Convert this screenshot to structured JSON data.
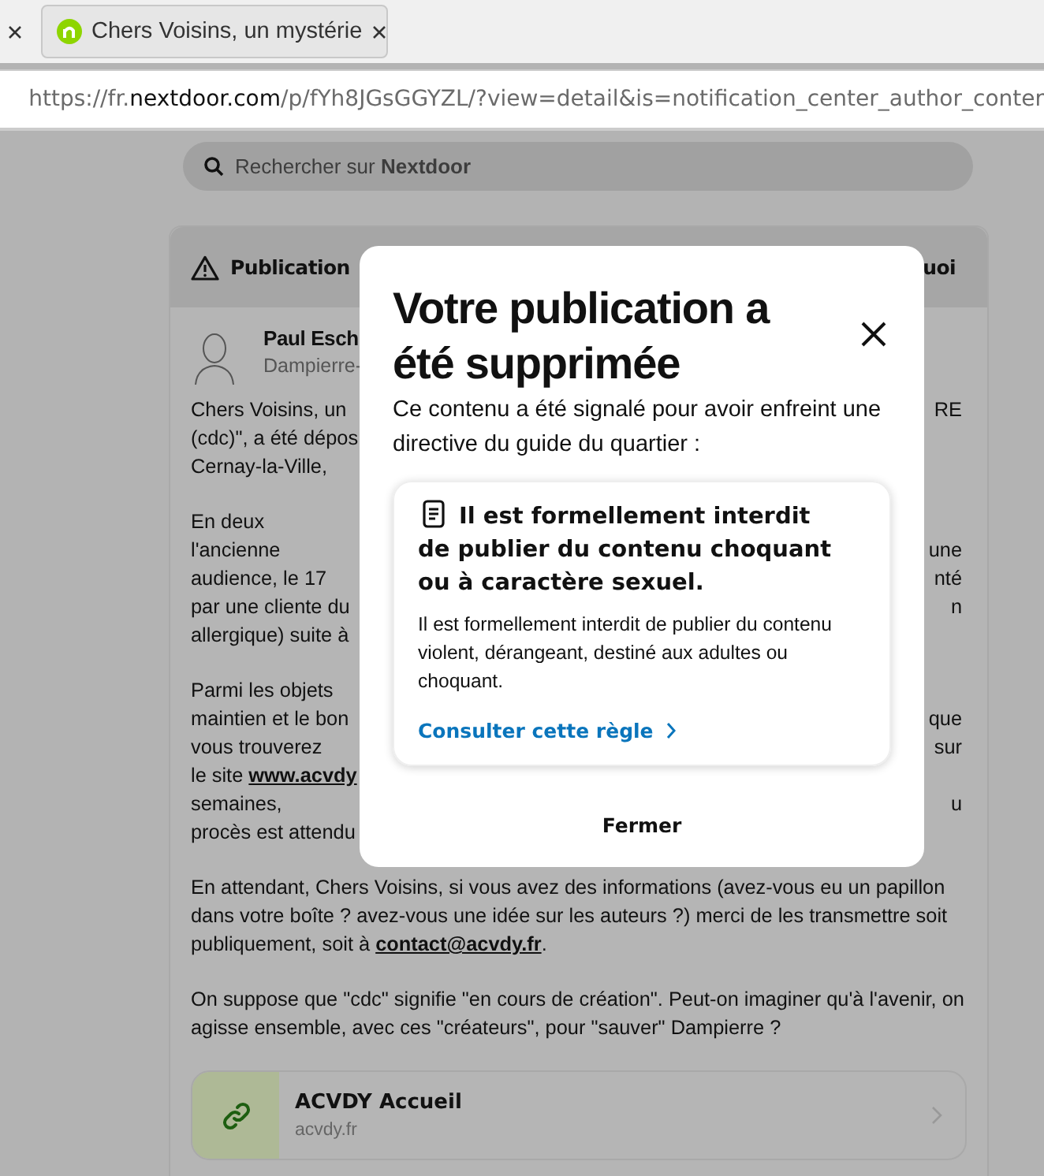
{
  "browser": {
    "tab": {
      "title": "Chers Voisins, un mystérie",
      "selected": true
    },
    "url": {
      "prefix": "https://fr.",
      "domain": "nextdoor.com",
      "path": "/p/fYh8JGsGGYZL/?view=detail&is=notification_center_author_conter"
    }
  },
  "search": {
    "placeholder": "Rechercher sur **Nextdoor**"
  },
  "post": {
    "header_left": "Publication",
    "header_right": "uoi",
    "author": "Paul Esch",
    "location": "Dampierre-",
    "paragraphs": [
      {
        "lines": [
          {
            "left": "Chers Voisins, un ",
            "right": "RE"
          },
          {
            "left": "(cdc)\", a été dépos"
          },
          {
            "left": "Cernay-la-Ville,"
          }
        ]
      },
      {
        "lines": [
          {
            "left": "En deux"
          },
          {
            "left": "l'ancienne",
            "right": "une"
          },
          {
            "left": "audience, le 17",
            "right": "nté"
          },
          {
            "left": "par une cliente du ",
            "right": "n"
          },
          {
            "left": "allergique) suite à "
          }
        ]
      },
      {
        "lines": [
          {
            "left": "Parmi les objets"
          },
          {
            "left": "maintien et le bon ",
            "right": "que"
          },
          {
            "left": "vous trouverez",
            "right": "sur"
          },
          {
            "left": "le site ",
            "link": "www.acvdy"
          },
          {
            "left": "semaines,",
            "right": "u"
          },
          {
            "left": "procès est attendu"
          }
        ]
      },
      {
        "text": "En attendant, Chers Voisins, si vous avez des informations (avez-vous eu un papillon dans votre boîte ? avez-vous une idée sur les auteurs ?) merci de les transmettre soit publiquement, soit à ",
        "link": "contact@acvdy.fr",
        "after": "."
      },
      {
        "text": "On suppose que \"cdc\" signifie \"en cours de création\". Peut-on imaginer qu'à l'avenir, on agisse ensemble, avec ces \"créateurs\", pour \"sauver\" Dampierre ?"
      }
    ],
    "link_card": {
      "title": "ACVDY Accueil",
      "domain": "acvdy.fr"
    }
  },
  "dialog": {
    "title": "Votre publication a été supprimée",
    "message": "Ce contenu a été signalé pour avoir enfreint une directive du guide du quartier :",
    "rule": {
      "title": "Il est formellement interdit de publier du contenu choquant ou à caractère sexuel.",
      "description": "Il est formellement interdit de publier du contenu violent, dérangeant, destiné aux adultes ou choquant.",
      "link": "Consulter cette règle"
    },
    "button": "Fermer"
  }
}
